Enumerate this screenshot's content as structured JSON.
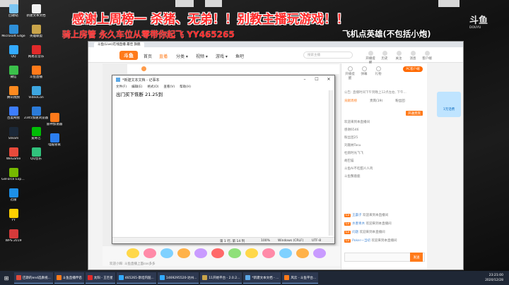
{
  "banners": {
    "line1": "感谢上周榜一 杀猪、无弟！！别教主播玩游戏！！",
    "line2": "骑上房管 永久车位从零带你起飞 YY465265",
    "line3": "飞机点英雄(不包括小炮)"
  },
  "desktop_icons_left": [
    {
      "label": "回收站",
      "color": "#7cc5f2"
    },
    {
      "label": "Microsoft Edge",
      "color": "#2e8fd8"
    },
    {
      "label": "QQ",
      "color": "#33aaff"
    },
    {
      "label": "微信",
      "color": "#3bc04a"
    },
    {
      "label": "腾讯视频",
      "color": "#ff8a1f"
    },
    {
      "label": "百度网盘",
      "color": "#3d7dfd"
    },
    {
      "label": "Steam",
      "color": "#1b2838"
    },
    {
      "label": "WeGame",
      "color": "#e84a3b"
    },
    {
      "label": "GeForce Experience",
      "color": "#76b900"
    },
    {
      "label": "迅雷",
      "color": "#1d8fe6"
    },
    {
      "label": "YY",
      "color": "#ffd000"
    },
    {
      "label": "WPS 2019",
      "color": "#d43a3a"
    },
    {
      "label": "雷神加速器",
      "color": "#ff7a1a"
    },
    {
      "label": "电脑管家",
      "color": "#2b7ef0"
    }
  ],
  "desktop_icons_second": [
    {
      "label": "新建文本文档",
      "color": "#f2f2f2"
    },
    {
      "label": "英雄联盟",
      "color": "#c9a44a"
    },
    {
      "label": "网易云音乐",
      "color": "#e02a2a"
    },
    {
      "label": "斗鱼直播",
      "color": "#ff7a1a"
    },
    {
      "label": "VideoCon",
      "color": "#3da6e0"
    },
    {
      "label": "2345加速浏览器",
      "color": "#2b7bd9"
    },
    {
      "label": "爱奇艺",
      "color": "#00be06"
    },
    {
      "label": "QQ音乐",
      "color": "#31c27c"
    }
  ],
  "browser": {
    "tab_title": "斗鱼(Live)在线直播 最佳 旗舰",
    "logo": "斗鱼",
    "nav": {
      "home": "首页",
      "recreation": "直播",
      "category": "分类 ▾",
      "video": "视频 ▾",
      "game": "游戏 ▾",
      "yuba": "鱼吧"
    },
    "search_placeholder": "搜索主播",
    "nav_icons": [
      "开播提醒",
      "历史",
      "关注",
      "消息",
      "客户端"
    ],
    "pc_button": "PC客户端",
    "right_icons": [
      "开播提醒",
      "弹幕",
      "礼物",
      "直播间",
      "排行榜"
    ],
    "notice": "公告: 直播时间下午到晚上12点左右, 下午...",
    "tabs": [
      "贡献周榜",
      "贵宾(19)",
      "粉丝团"
    ],
    "gift_button": "开通贵宾",
    "chat_plain": [
      "欢迎来到本直播间",
      "感谢6546",
      "粉丝团25",
      "刘嘉纳Tasu",
      "杜鹃时光飞飞",
      "胡巴猫",
      "斗鱼Ai不吃甜人人鸡",
      "斗鱼蟹鹿鹿"
    ],
    "chat_badged": [
      {
        "name": "王霸子",
        "text": "欢迎来到本直播间"
      },
      {
        "name": "水墨青木",
        "text": "欢迎来到本直播间"
      },
      {
        "name": "问题",
        "text": "欢迎来到本直播间"
      },
      {
        "name": "Poker一当初",
        "text": "欢迎来到本直播间"
      }
    ],
    "send_button": "发送",
    "bottom_status": "欢迎小辉: 斗鱼直播上面cos多多"
  },
  "overlay": {
    "logo": "斗鱼",
    "logo_sub": "DOUYU",
    "phone_ad": "1元话费"
  },
  "notepad": {
    "title": "*新建文本文档 - 记事本",
    "menu": [
      "文件(F)",
      "编辑(E)",
      "格式(O)",
      "查看(V)",
      "帮助(H)"
    ],
    "content": "出门买下恢断 21.25到",
    "status": {
      "pos": "第 1 行, 第 14 列",
      "zoom": "100%",
      "eol": "Windows (CRLF)",
      "encoding": "UTF-8"
    }
  },
  "taskbar": {
    "items": [
      {
        "label": "巴斯的end选奏视...",
        "color": "#e04a3a"
      },
      {
        "label": "斗鱼直播伴侣",
        "color": "#ff7a1a"
      },
      {
        "label": "太阳 - 王巨星",
        "color": "#e02a2a"
      },
      {
        "label": "465265-斯坦内脏...",
        "color": "#33aaff"
      },
      {
        "label": "1469295520-达州...",
        "color": "#33aaff"
      },
      {
        "label": "11开始平台 - 2.0.2...",
        "color": "#c9a44a"
      },
      {
        "label": "*新建文本文档 - ...",
        "color": "#5ba8e6"
      },
      {
        "label": "风云 - 斗鱼平台...",
        "color": "#ff7a1a"
      }
    ],
    "time": "23:21:00",
    "date": "2020/12/28"
  }
}
